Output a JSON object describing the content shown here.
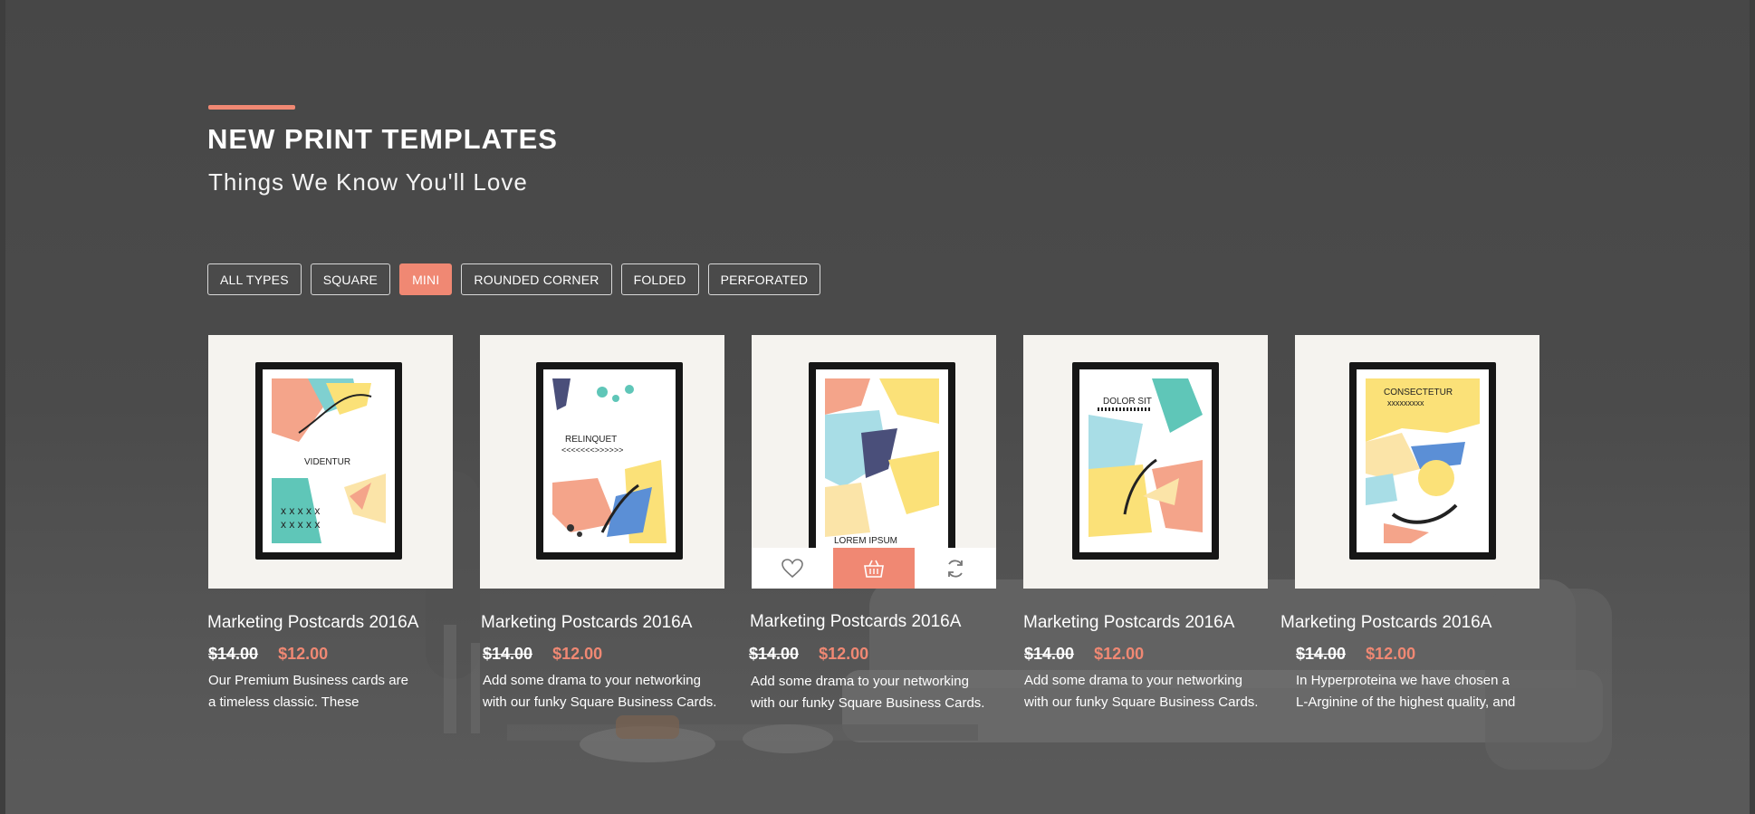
{
  "section": {
    "title": "NEW PRINT TEMPLATES",
    "subtitle": "Things We Know You'll Love"
  },
  "filters": [
    {
      "label": "ALL TYPES",
      "active": false
    },
    {
      "label": "SQUARE",
      "active": false
    },
    {
      "label": "MINI",
      "active": true
    },
    {
      "label": "ROUNDED CORNER",
      "active": false
    },
    {
      "label": "FOLDED",
      "active": false
    },
    {
      "label": "PERFORATED",
      "active": false
    }
  ],
  "products": [
    {
      "name": "Marketing Postcards 2016A",
      "old_price": "$14.00",
      "new_price": "$12.00",
      "desc_line1": "Our Premium Business cards are",
      "desc_line2": "a timeless classic. These",
      "poster_text": "VIDENTUR"
    },
    {
      "name": "Marketing Postcards 2016A",
      "old_price": "$14.00",
      "new_price": "$12.00",
      "desc_line1": "Add some drama to your networking",
      "desc_line2": "with our funky Square Business Cards.",
      "poster_text": "RELINQUET"
    },
    {
      "name": "Marketing Postcards 2016A",
      "old_price": "$14.00",
      "new_price": "$12.00",
      "desc_line1": "Add some drama to your networking",
      "desc_line2": "with our funky Square Business Cards.",
      "poster_text": "LOREM IPSUM"
    },
    {
      "name": "Marketing Postcards 2016A",
      "old_price": "$14.00",
      "new_price": "$12.00",
      "desc_line1": "Add some drama to your networking",
      "desc_line2": "with our funky Square Business Cards.",
      "poster_text": "DOLOR SIT"
    },
    {
      "name": "Marketing Postcards 2016A",
      "old_price": "$14.00",
      "new_price": "$12.00",
      "desc_line1": "In Hyperproteina we have chosen a",
      "desc_line2": "L-Arginine of the highest quality, and",
      "poster_text": "CONSECTETUR"
    }
  ],
  "hover_actions": [
    "heart-icon",
    "basket-icon",
    "refresh-icon"
  ],
  "colors": {
    "accent": "#f08873",
    "overlay": "#4a4a4a"
  }
}
